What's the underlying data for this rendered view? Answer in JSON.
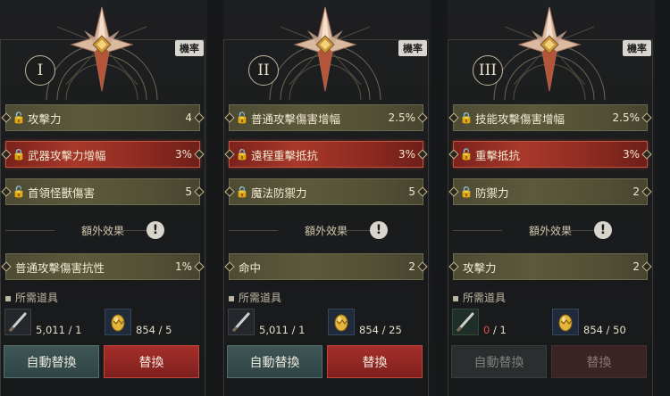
{
  "panels": [
    {
      "numeral": "I",
      "rate_badge": "機率",
      "stats": [
        {
          "name": "攻擊力",
          "value": "4",
          "locked": false
        },
        {
          "name": "武器攻擊力增幅",
          "value": "3%",
          "locked": true
        },
        {
          "name": "首領怪獸傷害",
          "value": "5",
          "locked": false
        }
      ],
      "extra_title": "額外效果",
      "extra_stat": {
        "name": "普通攻擊傷害抗性",
        "value": "1%"
      },
      "req_label": "▪ 所需道具",
      "item1_count": "5,011 / 1",
      "item1_have": "",
      "item2_count": "854 / 5",
      "auto_label": "自動替換",
      "swap_label": "替換"
    },
    {
      "numeral": "II",
      "rate_badge": "機率",
      "stats": [
        {
          "name": "普通攻擊傷害增幅",
          "value": "2.5%",
          "locked": false
        },
        {
          "name": "遠程重擊抵抗",
          "value": "3%",
          "locked": true
        },
        {
          "name": "魔法防禦力",
          "value": "5",
          "locked": true
        }
      ],
      "extra_title": "額外效果",
      "extra_stat": {
        "name": "命中",
        "value": "2"
      },
      "req_label": "▪ 所需道具",
      "item1_count": "5,011 / 1",
      "item1_have": "",
      "item2_count": "854 / 25",
      "auto_label": "自動替換",
      "swap_label": "替換"
    },
    {
      "numeral": "III",
      "rate_badge": "機率",
      "stats": [
        {
          "name": "技能攻擊傷害增幅",
          "value": "2.5%",
          "locked": true
        },
        {
          "name": "重擊抵抗",
          "value": "3%",
          "locked": false
        },
        {
          "name": "防禦力",
          "value": "2",
          "locked": true
        }
      ],
      "extra_title": "額外效果",
      "extra_stat": {
        "name": "攻擊力",
        "value": "2"
      },
      "req_label": "▪ 所需道具",
      "item1_count": " / 1",
      "item1_have": "0",
      "item2_count": "854 / 50",
      "auto_label": "自動替換",
      "swap_label": "替換"
    }
  ],
  "icons": {
    "lock": "lock-icon",
    "unlock": "unlock-icon",
    "info": "exclamation-icon",
    "blade": "blade-icon",
    "egg": "golden-egg-icon",
    "emblem": "compass-star-emblem"
  },
  "colors": {
    "highlight_red": "#a8392a",
    "olive": "#5c5a3c",
    "auto_button": "#3f5656",
    "swap_button": "#a52e2a",
    "shortage": "#e0524a"
  }
}
